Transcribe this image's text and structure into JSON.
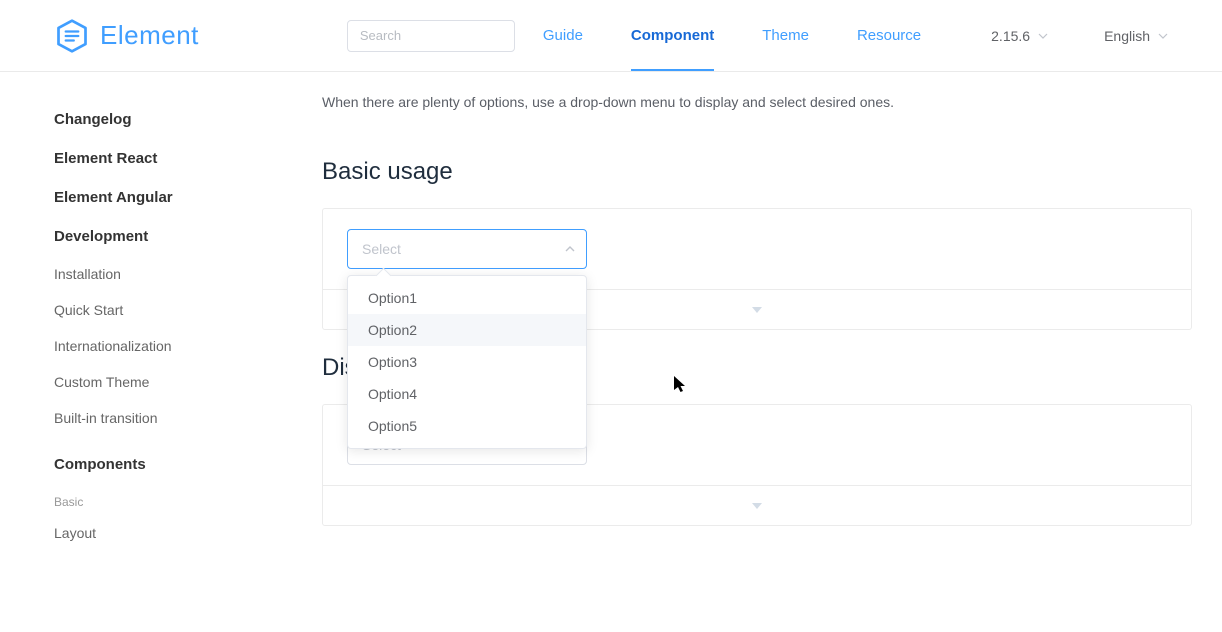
{
  "header": {
    "logo_text": "Element",
    "search_placeholder": "Search",
    "nav": [
      "Guide",
      "Component",
      "Theme",
      "Resource"
    ],
    "version": "2.15.6",
    "language": "English"
  },
  "sidebar": {
    "top_links": [
      "Changelog",
      "Element React",
      "Element Angular",
      "Development"
    ],
    "dev_sub": [
      "Installation",
      "Quick Start",
      "Internationalization",
      "Custom Theme",
      "Built-in transition"
    ],
    "components_heading": "Components",
    "group_label": "Basic",
    "group_items": [
      "Layout"
    ]
  },
  "content": {
    "intro": "When there are plenty of options, use a drop-down menu to display and select desired ones.",
    "section1_title": "Basic usage",
    "section2_title_partial": "Dis",
    "select_placeholder": "Select",
    "options": [
      "Option1",
      "Option2",
      "Option3",
      "Option4",
      "Option5"
    ]
  }
}
